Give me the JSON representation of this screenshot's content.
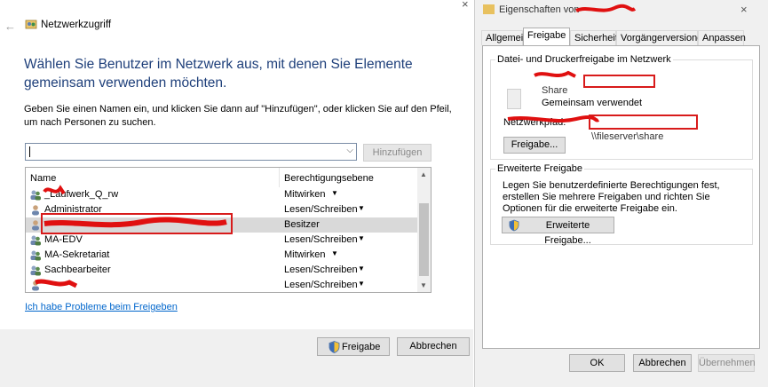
{
  "left_dialog": {
    "title": "Netzwerkzugriff",
    "heading": "Wählen Sie Benutzer im Netzwerk aus, mit denen Sie Elemente gemeinsam verwenden möchten.",
    "instructions": "Geben Sie einen Namen ein, und klicken Sie dann auf \"Hinzufügen\", oder klicken Sie auf den Pfeil, um nach Personen zu suchen.",
    "input_value": "",
    "add_button": "Hinzufügen",
    "columns": {
      "name": "Name",
      "permission": "Berechtigungsebene"
    },
    "rows": [
      {
        "name": "_Laufwerk_Q_rw",
        "permission": "Mitwirken",
        "icon": "group-icon",
        "has_dropdown": true
      },
      {
        "name": "Administrator",
        "permission": "Lesen/Schreiben",
        "icon": "user-icon",
        "has_dropdown": true
      },
      {
        "name": "",
        "permission": "Besitzer",
        "icon": "user-icon",
        "has_dropdown": false
      },
      {
        "name": "MA-EDV",
        "permission": "Lesen/Schreiben",
        "icon": "group-icon",
        "has_dropdown": true
      },
      {
        "name": "MA-Sekretariat",
        "permission": "Mitwirken",
        "icon": "group-icon",
        "has_dropdown": true
      },
      {
        "name": "Sachbearbeiter",
        "permission": "Lesen/Schreiben",
        "icon": "group-icon",
        "has_dropdown": true
      },
      {
        "name": "",
        "permission": "Lesen/Schreiben",
        "icon": "user-icon",
        "has_dropdown": true
      }
    ],
    "help_link": "Ich habe Probleme beim Freigeben",
    "share_button": "Freigabe",
    "cancel_button": "Abbrechen"
  },
  "right_dialog": {
    "title": "Eigenschaften von",
    "tabs": [
      "Allgemein",
      "Freigabe",
      "Sicherheit",
      "Vorgängerversionen",
      "Anpassen"
    ],
    "active_tab": "Freigabe",
    "network_group_title": "Datei- und Druckerfreigabe im Netzwerk",
    "share_name": "Share",
    "share_state": "Gemeinsam verwendet",
    "network_path_label": "Netzwerkpfad:",
    "network_path_value": "\\\\fileserver\\share",
    "share_button": "Freigabe...",
    "advanced_group_title": "Erweiterte Freigabe",
    "advanced_text": "Legen Sie benutzerdefinierte Berechtigungen fest, erstellen Sie mehrere Freigaben und richten Sie Optionen für die erweiterte Freigabe ein.",
    "advanced_button": "Erweiterte Freigabe...",
    "ok_button": "OK",
    "cancel_button": "Abbrechen",
    "apply_button": "Übernehmen"
  },
  "colors": {
    "heading": "#1e3f7a",
    "link": "#0066cc",
    "highlight": "#d81b1b",
    "selection": "#d9d9d9"
  }
}
